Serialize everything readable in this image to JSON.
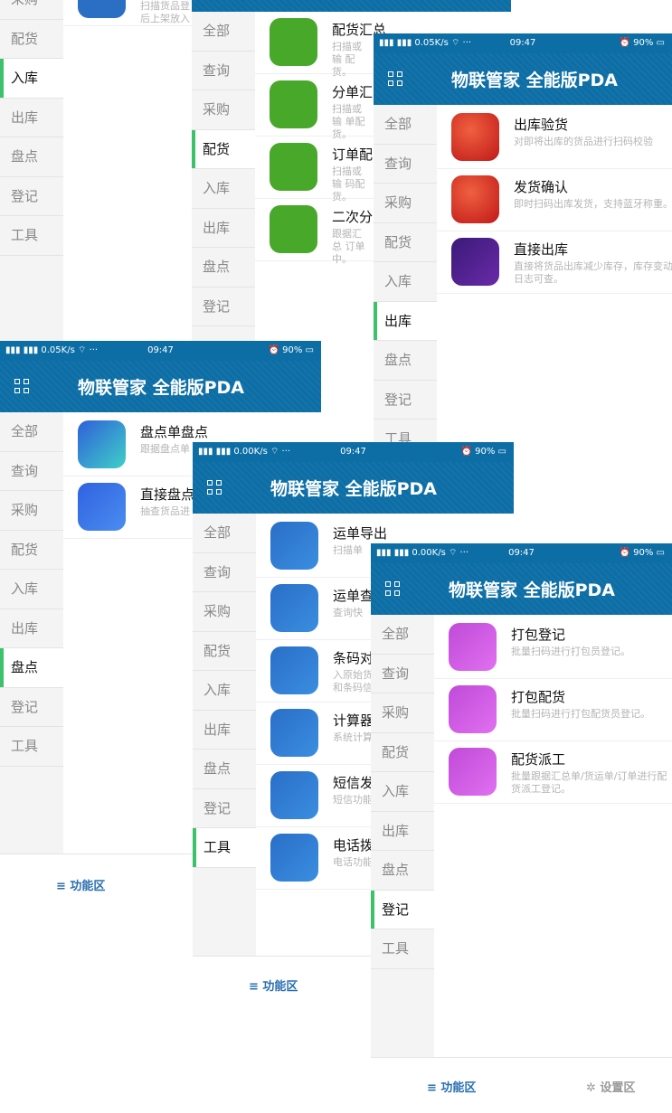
{
  "header": {
    "title": "物联管家 全能版PDA"
  },
  "sidebar_labels": [
    "全部",
    "查询",
    "采购",
    "配货",
    "入库",
    "出库",
    "盘点",
    "登记",
    "工具"
  ],
  "footer": {
    "function_area": "≡ 功能区",
    "settings_area": "✲ 设置区"
  },
  "panel_a": {
    "top_partial_label": "采购",
    "sidebar": [
      "配货",
      "入库",
      "出库",
      "盘点",
      "登记",
      "工具"
    ],
    "active": "入库",
    "row": {
      "desc": "扫描货品登 后上架放入"
    }
  },
  "panel_b": {
    "sidebar": [
      "全部",
      "查询",
      "采购",
      "配货",
      "入库",
      "出库",
      "盘点",
      "登记"
    ],
    "active": "配货",
    "rows": [
      {
        "name": "配货汇总",
        "desc": "扫描或输 配货。"
      },
      {
        "name": "分单汇",
        "desc": "扫描或输 单配货。"
      },
      {
        "name": "订单配",
        "desc": "扫描或输 码配货。"
      },
      {
        "name": "二次分",
        "desc": "跟据汇总 订单中。"
      }
    ]
  },
  "panel_c": {
    "status": {
      "left": "0.05K/s",
      "time": "09:47",
      "right": "90%"
    },
    "sidebar": [
      "全部",
      "查询",
      "采购",
      "配货",
      "入库",
      "出库",
      "盘点",
      "登记",
      "工具"
    ],
    "active": "出库",
    "rows": [
      {
        "name": "出库验货",
        "desc": "对即将出库的货品进行扫码校验"
      },
      {
        "name": "发货确认",
        "desc": "即时扫码出库发货，支持蓝牙称重。"
      },
      {
        "name": "直接出库",
        "desc": "直接将货品出库减少库存，库存变动日志可查。"
      }
    ]
  },
  "panel_d": {
    "status": {
      "left": "0.05K/s",
      "time": "09:47",
      "right": "90%"
    },
    "active": "盘点",
    "rows": [
      {
        "name": "盘点单盘点",
        "desc": "跟据盘点单"
      },
      {
        "name": "直接盘点",
        "desc": "抽查货品进"
      }
    ]
  },
  "panel_e": {
    "status": {
      "left": "0.00K/s",
      "time": "09:47",
      "right": "90%"
    },
    "active": "工具",
    "rows": [
      {
        "name": "运单导出",
        "desc": "扫描单"
      },
      {
        "name": "运单查",
        "desc": "查询快"
      },
      {
        "name": "条码对",
        "desc": "入原始货 和条码信"
      },
      {
        "name": "计算器",
        "desc": "系统计算"
      },
      {
        "name": "短信发",
        "desc": "短信功能"
      },
      {
        "name": "电话拨",
        "desc": "电话功能"
      }
    ]
  },
  "panel_f": {
    "status": {
      "left": "0.00K/s",
      "time": "09:47",
      "right": "90%"
    },
    "active": "登记",
    "rows": [
      {
        "name": "打包登记",
        "desc": "批量扫码进行打包员登记。"
      },
      {
        "name": "打包配货",
        "desc": "批量扫码进行打包配货员登记。"
      },
      {
        "name": "配货派工",
        "desc": "批量跟据汇总单/货运单/订单进行配货派工登记。"
      }
    ]
  },
  "icons": {
    "panel_a": [
      "shelf-icon"
    ],
    "panel_b": [
      "boxes-pallet-icon",
      "cart-boxes-icon",
      "clipboard-check-icon",
      "basket-box-icon"
    ],
    "panel_c": [
      "box-inspect-icon",
      "box-check-icon",
      "box-scan-icon"
    ],
    "panel_d": [
      "checklist-search-icon",
      "clipboard-list-icon"
    ],
    "panel_e": [
      "express-package-icon",
      "courier-icon",
      "barcode-vs-icon",
      "calculator-icon",
      "chat-bubble-icon",
      "whatsapp-phone-icon"
    ],
    "panel_f": [
      "packer-person-icon",
      "people-pair-icon",
      "team-assign-icon"
    ]
  },
  "colors": {
    "header": "#0d6ea6",
    "active_bar": "#3cc26a",
    "link": "#2a6fb0"
  }
}
